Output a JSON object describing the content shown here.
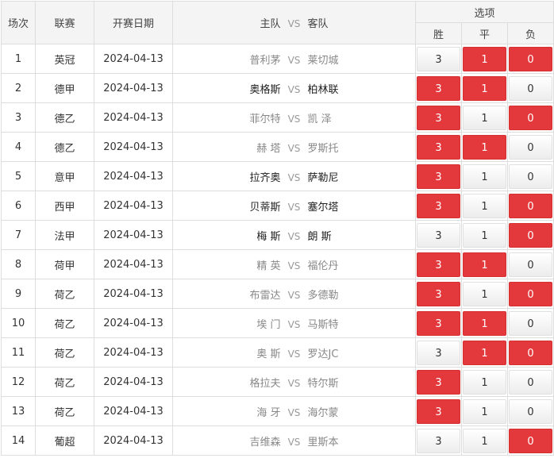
{
  "header": {
    "no": "场次",
    "league": "联赛",
    "date": "开赛日期",
    "home": "主队",
    "vs": "VS",
    "away": "客队",
    "options": "选项",
    "win": "胜",
    "draw": "平",
    "lose": "负"
  },
  "rows": [
    {
      "no": "1",
      "league": "英冠",
      "date": "2024-04-13",
      "home": "普利茅",
      "vs": "VS",
      "away": "莱切城",
      "win": "3",
      "draw": "1",
      "lose": "0",
      "sel": [
        false,
        true,
        true
      ],
      "strong": false
    },
    {
      "no": "2",
      "league": "德甲",
      "date": "2024-04-13",
      "home": "奥格斯",
      "vs": "VS",
      "away": "柏林联",
      "win": "3",
      "draw": "1",
      "lose": "0",
      "sel": [
        true,
        true,
        false
      ],
      "strong": true
    },
    {
      "no": "3",
      "league": "德乙",
      "date": "2024-04-13",
      "home": "菲尔特",
      "vs": "VS",
      "away": "凯 泽",
      "win": "3",
      "draw": "1",
      "lose": "0",
      "sel": [
        true,
        false,
        true
      ],
      "strong": false
    },
    {
      "no": "4",
      "league": "德乙",
      "date": "2024-04-13",
      "home": "赫 塔",
      "vs": "VS",
      "away": "罗斯托",
      "win": "3",
      "draw": "1",
      "lose": "0",
      "sel": [
        true,
        true,
        false
      ],
      "strong": false
    },
    {
      "no": "5",
      "league": "意甲",
      "date": "2024-04-13",
      "home": "拉齐奥",
      "vs": "VS",
      "away": "萨勒尼",
      "win": "3",
      "draw": "1",
      "lose": "0",
      "sel": [
        true,
        false,
        false
      ],
      "strong": true
    },
    {
      "no": "6",
      "league": "西甲",
      "date": "2024-04-13",
      "home": "贝蒂斯",
      "vs": "VS",
      "away": "塞尔塔",
      "win": "3",
      "draw": "1",
      "lose": "0",
      "sel": [
        true,
        false,
        true
      ],
      "strong": true
    },
    {
      "no": "7",
      "league": "法甲",
      "date": "2024-04-13",
      "home": "梅 斯",
      "vs": "VS",
      "away": "朗 斯",
      "win": "3",
      "draw": "1",
      "lose": "0",
      "sel": [
        false,
        false,
        true
      ],
      "strong": true
    },
    {
      "no": "8",
      "league": "荷甲",
      "date": "2024-04-13",
      "home": "精 英",
      "vs": "VS",
      "away": "福伦丹",
      "win": "3",
      "draw": "1",
      "lose": "0",
      "sel": [
        true,
        true,
        false
      ],
      "strong": false
    },
    {
      "no": "9",
      "league": "荷乙",
      "date": "2024-04-13",
      "home": "布雷达",
      "vs": "VS",
      "away": "多德勒",
      "win": "3",
      "draw": "1",
      "lose": "0",
      "sel": [
        true,
        false,
        true
      ],
      "strong": false
    },
    {
      "no": "10",
      "league": "荷乙",
      "date": "2024-04-13",
      "home": "埃 门",
      "vs": "VS",
      "away": "马斯特",
      "win": "3",
      "draw": "1",
      "lose": "0",
      "sel": [
        true,
        true,
        false
      ],
      "strong": false
    },
    {
      "no": "11",
      "league": "荷乙",
      "date": "2024-04-13",
      "home": "奥 斯",
      "vs": "VS",
      "away": "罗达JC",
      "win": "3",
      "draw": "1",
      "lose": "0",
      "sel": [
        false,
        true,
        true
      ],
      "strong": false
    },
    {
      "no": "12",
      "league": "荷乙",
      "date": "2024-04-13",
      "home": "格拉夫",
      "vs": "VS",
      "away": "特尔斯",
      "win": "3",
      "draw": "1",
      "lose": "0",
      "sel": [
        true,
        false,
        false
      ],
      "strong": false
    },
    {
      "no": "13",
      "league": "荷乙",
      "date": "2024-04-13",
      "home": "海 牙",
      "vs": "VS",
      "away": "海尔蒙",
      "win": "3",
      "draw": "1",
      "lose": "0",
      "sel": [
        true,
        false,
        false
      ],
      "strong": false
    },
    {
      "no": "14",
      "league": "葡超",
      "date": "2024-04-13",
      "home": "吉维森",
      "vs": "VS",
      "away": "里斯本",
      "win": "3",
      "draw": "1",
      "lose": "0",
      "sel": [
        false,
        false,
        true
      ],
      "strong": false
    }
  ],
  "colors": {
    "selected": "#e4393c",
    "header_bg": "#f4f4f4",
    "border": "#dddddd"
  }
}
